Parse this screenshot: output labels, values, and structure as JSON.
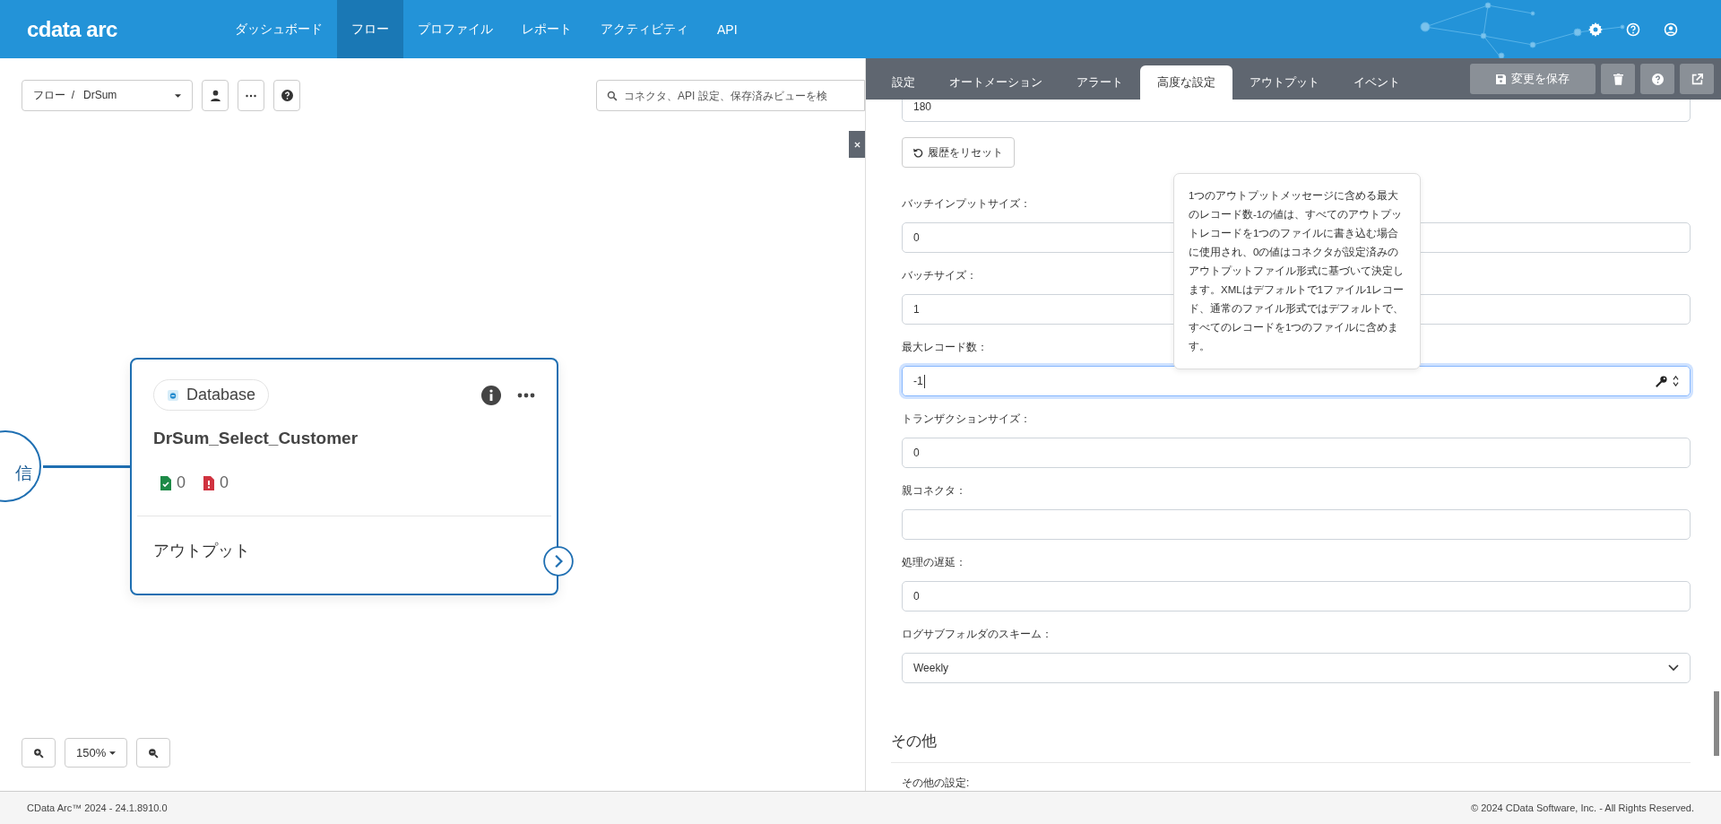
{
  "header": {
    "logo": "cdata arc",
    "nav": [
      {
        "label": "ダッシュボード",
        "selected": false
      },
      {
        "label": "フロー",
        "selected": true
      },
      {
        "label": "プロファイル",
        "selected": false
      },
      {
        "label": "レポート",
        "selected": false
      },
      {
        "label": "アクティビティ",
        "selected": false
      },
      {
        "label": "API",
        "selected": false
      }
    ]
  },
  "toolbar": {
    "breadcrumb": [
      "フロー",
      "DrSum"
    ],
    "separator": "/",
    "search_placeholder": "コネクタ、API 設定、保存済みビューを検"
  },
  "canvas": {
    "prev_node": {
      "label": "信"
    },
    "node": {
      "type": "Database",
      "name": "DrSum_Select_Customer",
      "success_count": "0",
      "error_count": "0",
      "output_label": "アウトプット"
    },
    "zoom": "150%"
  },
  "panel": {
    "tabs": [
      {
        "label": "設定",
        "selected": false
      },
      {
        "label": "オートメーション",
        "selected": false
      },
      {
        "label": "アラート",
        "selected": false
      },
      {
        "label": "高度な設定",
        "selected": true
      },
      {
        "label": "アウトプット",
        "selected": false
      },
      {
        "label": "イベント",
        "selected": false
      }
    ],
    "save_button": "変更を保存",
    "items": [
      {
        "kind": "input",
        "value": "180",
        "focused": false
      },
      {
        "kind": "reset",
        "label": "履歴をリセット"
      },
      {
        "kind": "input",
        "label": "バッチインプットサイズ：",
        "value": "0",
        "focused": false
      },
      {
        "kind": "input",
        "label": "バッチサイズ：",
        "value": "1",
        "focused": false
      },
      {
        "kind": "input",
        "label": "最大レコード数：",
        "value": "-1",
        "focused": true
      },
      {
        "kind": "input",
        "label": "トランザクションサイズ：",
        "value": "0",
        "focused": false
      },
      {
        "kind": "input",
        "label": "親コネクタ：",
        "value": "",
        "focused": false
      },
      {
        "kind": "input",
        "label": "処理の遅延：",
        "value": "0",
        "focused": false
      },
      {
        "kind": "select",
        "label": "ログサブフォルダのスキーム：",
        "value": "Weekly"
      }
    ],
    "tooltip": "1つのアウトプットメッセージに含める最大のレコード数-1の値は、すべてのアウトプットレコードを1つのファイルに書き込む場合に使用され、0の値はコネクタが設定済みのアウトプットファイル形式に基づいて決定します。XMLはデフォルトで1ファイル1レコード、通常のファイル形式ではデフォルトで、すべてのレコードを1つのファイルに含めます。",
    "section": {
      "title": "その他",
      "label": "その他の設定:"
    }
  },
  "footer": {
    "version": "CData Arc™ 2024 - 24.1.8910.0",
    "copyright": "© 2024 CData Software, Inc. - All Rights Reserved."
  }
}
